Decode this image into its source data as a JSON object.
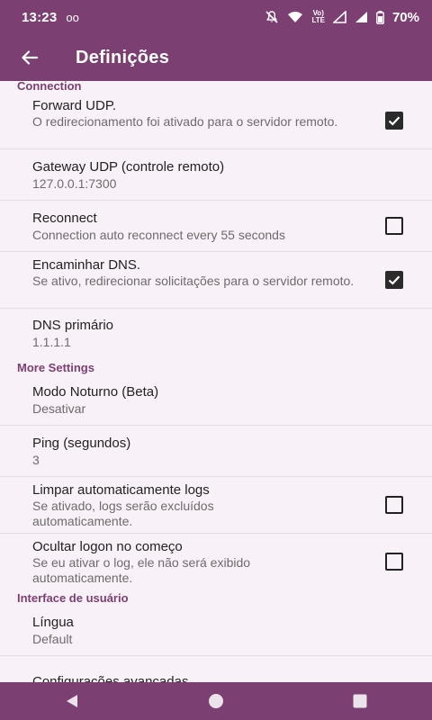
{
  "status": {
    "time": "13:23",
    "voicemail": "oo",
    "lte_top": "Vo)",
    "lte_bottom": "LTE",
    "battery": "70%"
  },
  "appbar": {
    "title": "Definições"
  },
  "sections": {
    "connection": "Connection",
    "more": "More Settings",
    "ui": "Interface de usuário"
  },
  "prefs": {
    "forward_udp": {
      "title": "Forward UDP.",
      "summary": "O redirecionamento foi ativado para o servidor remoto.",
      "checked": true
    },
    "gateway_udp": {
      "title": "Gateway UDP (controle remoto)",
      "summary": "127.0.0.1:7300"
    },
    "reconnect": {
      "title": "Reconnect",
      "summary": "Connection auto reconnect every 55 seconds",
      "checked": false
    },
    "dns_forward": {
      "title": "Encaminhar DNS.",
      "summary": "Se ativo, redirecionar solicitações para o servidor remoto.",
      "checked": true
    },
    "dns_primary": {
      "title": "DNS primário",
      "summary": "1.1.1.1"
    },
    "night_mode": {
      "title": "Modo Noturno (Beta)",
      "summary": "Desativar"
    },
    "ping": {
      "title": "Ping (segundos)",
      "summary": "3"
    },
    "auto_clear_logs": {
      "title": "Limpar automaticamente logs",
      "summary": "Se ativado, logs serão excluídos automaticamente.",
      "checked": false
    },
    "hide_logon": {
      "title": "Ocultar logon no começo",
      "summary": "Se eu ativar o log, ele não será exibido automaticamente.",
      "checked": false
    },
    "language": {
      "title": "Língua",
      "summary": "Default"
    },
    "advanced": {
      "title": "Configurações avançadas"
    }
  },
  "colors": {
    "primary": "#7b3f72",
    "background": "#f8f1f7",
    "section": "#7b3f72"
  }
}
